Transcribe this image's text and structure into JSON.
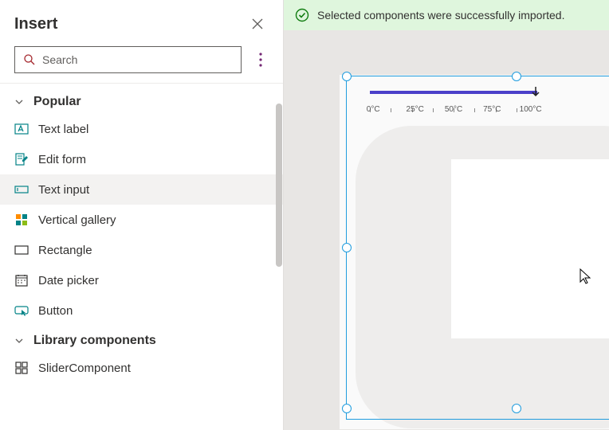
{
  "panel": {
    "title": "Insert",
    "search_placeholder": "Search"
  },
  "sections": {
    "popular": {
      "title": "Popular",
      "items": [
        {
          "label": "Text label"
        },
        {
          "label": "Edit form"
        },
        {
          "label": "Text input"
        },
        {
          "label": "Vertical gallery"
        },
        {
          "label": "Rectangle"
        },
        {
          "label": "Date picker"
        },
        {
          "label": "Button"
        }
      ]
    },
    "library": {
      "title": "Library components",
      "items": [
        {
          "label": "SliderComponent"
        }
      ]
    }
  },
  "banner": {
    "message": "Selected components were successfully imported."
  },
  "slider": {
    "labels": [
      "0°C",
      "25°C",
      "50°C",
      "75°C",
      "100°C"
    ]
  }
}
